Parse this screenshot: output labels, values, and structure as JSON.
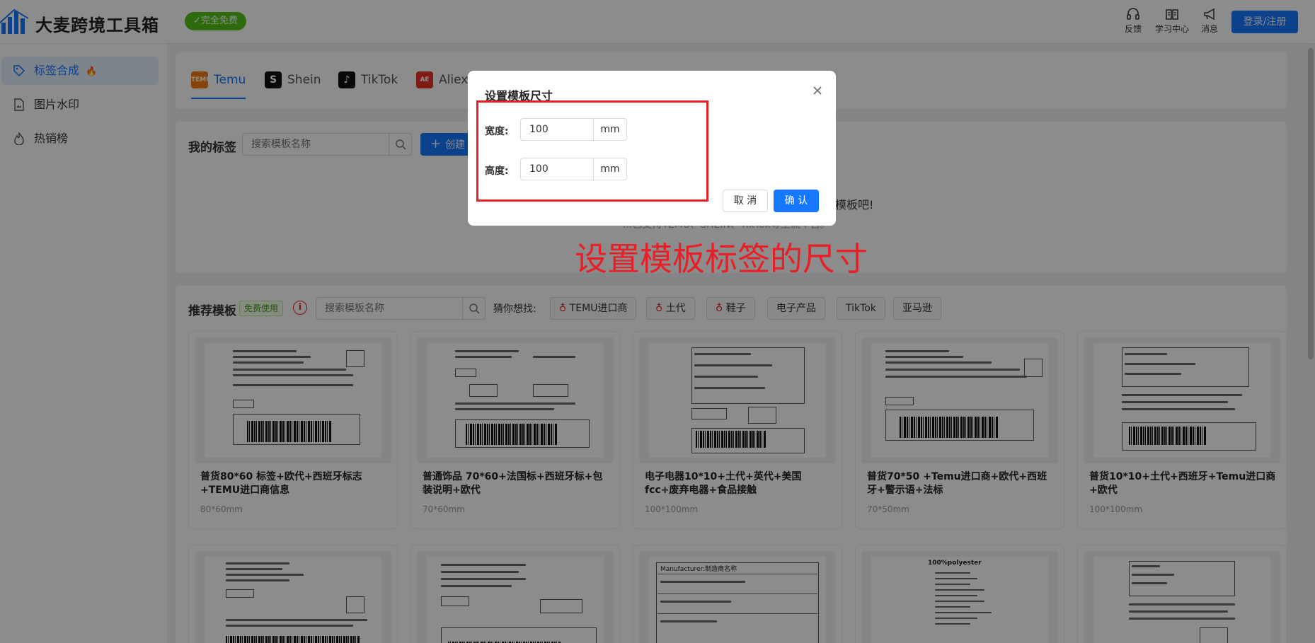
{
  "header": {
    "app_title": "大麦跨境工具箱",
    "free_badge": "✓完全免费",
    "feedback": "反馈",
    "learning": "学习中心",
    "messages": "消息",
    "login": "登录/注册",
    "accent_color": "#1677ff"
  },
  "sidebar": {
    "items": [
      {
        "label": "标签合成",
        "icon": "tag-icon",
        "badge": "🔥",
        "active": true
      },
      {
        "label": "图片水印",
        "icon": "image-file-icon",
        "active": false
      },
      {
        "label": "热销榜",
        "icon": "flame-icon",
        "active": false
      }
    ]
  },
  "tabs": [
    {
      "label": "Temu",
      "icon": "temu-logo",
      "active": true
    },
    {
      "label": "Shein",
      "icon": "shein-logo"
    },
    {
      "label": "TikTok",
      "icon": "tiktok-logo"
    },
    {
      "label": "Aliexp",
      "icon": "aliexpress-logo"
    }
  ],
  "my_labels": {
    "title": "我的标签",
    "search_placeholder": "搜索模板名称",
    "create_label": "创建",
    "empty_text": "模板吧!",
    "empty_sub": "...已支持TEMU、SHEIN、TikTok等主流平台。"
  },
  "annotation": "设置模板标签的尺寸",
  "recommended": {
    "title": "推荐模板",
    "free_tag": "免费使用",
    "search_placeholder": "搜索模板名称",
    "guess_label": "猜你想找:",
    "chips": [
      {
        "label": "TEMU进口商",
        "flame": true
      },
      {
        "label": "土代",
        "flame": true
      },
      {
        "label": "鞋子",
        "flame": true
      },
      {
        "label": "电子产品",
        "flame": false
      },
      {
        "label": "TikTok",
        "flame": false
      },
      {
        "label": "亚马逊",
        "flame": false
      }
    ],
    "templates": [
      {
        "name": "普货80*60 标签+欧代+西班牙标志+TEMU进口商信息",
        "size": "80*60mm"
      },
      {
        "name": "普通饰品 70*60+法国标+西班牙标+包装说明+欧代",
        "size": "70*60mm"
      },
      {
        "name": "电子电器10*10+土代+英代+美国fcc+废弃电器+食品接触",
        "size": "100*100mm"
      },
      {
        "name": "普货70*50 +Temu进口商+欧代+西班牙+警示语+法标",
        "size": "70*50mm"
      },
      {
        "name": "普货10*10+土代+西班牙+Temu进口商+欧代",
        "size": "100*100mm"
      }
    ],
    "row2_snippets": [
      "Manufacturer:制造商名称",
      "Manufacturer:制造商名称",
      "Manufacturer:制造商名称",
      "100%polyester",
      ""
    ]
  },
  "modal": {
    "title": "设置模板尺寸",
    "width_label": "宽度:",
    "width_value": "100",
    "height_label": "高度:",
    "height_value": "100",
    "unit": "mm",
    "cancel": "取 消",
    "confirm": "确 认",
    "highlight_color": "#e81f27"
  }
}
